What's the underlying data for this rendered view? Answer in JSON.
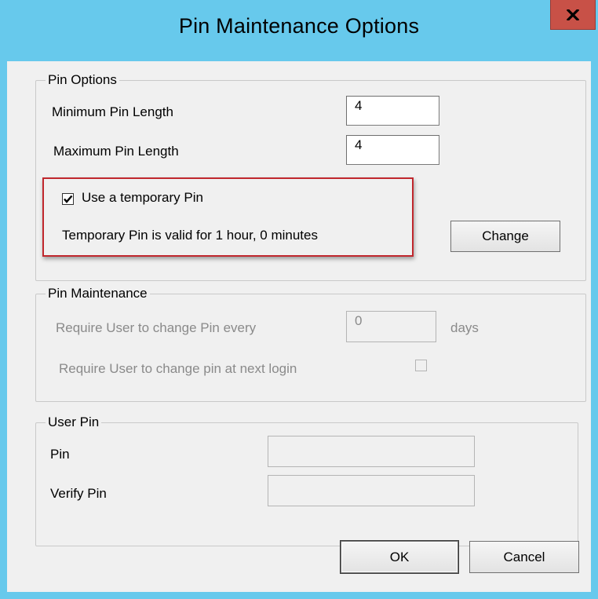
{
  "window": {
    "title": "Pin Maintenance Options",
    "close_label": "x"
  },
  "pin_options": {
    "legend": "Pin Options",
    "min_length_label": "Minimum Pin Length",
    "min_length_value": "4",
    "max_length_label": "Maximum Pin Length",
    "max_length_value": "4",
    "temp_pin_label": "Use a temporary Pin",
    "temp_pin_checked": true,
    "temp_pin_validity": "Temporary Pin is valid for 1 hour, 0 minutes",
    "change_label": "Change"
  },
  "pin_maintenance": {
    "legend": "Pin Maintenance",
    "change_every_label": "Require User to change Pin every",
    "change_every_value": "0",
    "days_label": "days",
    "next_login_label": "Require User to change pin at next login",
    "next_login_checked": false
  },
  "user_pin": {
    "legend": "User Pin",
    "pin_label": "Pin",
    "pin_value": "",
    "verify_label": "Verify Pin",
    "verify_value": ""
  },
  "footer": {
    "ok_label": "OK",
    "cancel_label": "Cancel"
  },
  "colors": {
    "titlebar": "#67c9ec",
    "close_button": "#c85147",
    "highlight_border": "#c0272d",
    "client_background": "#f0f0f0"
  }
}
